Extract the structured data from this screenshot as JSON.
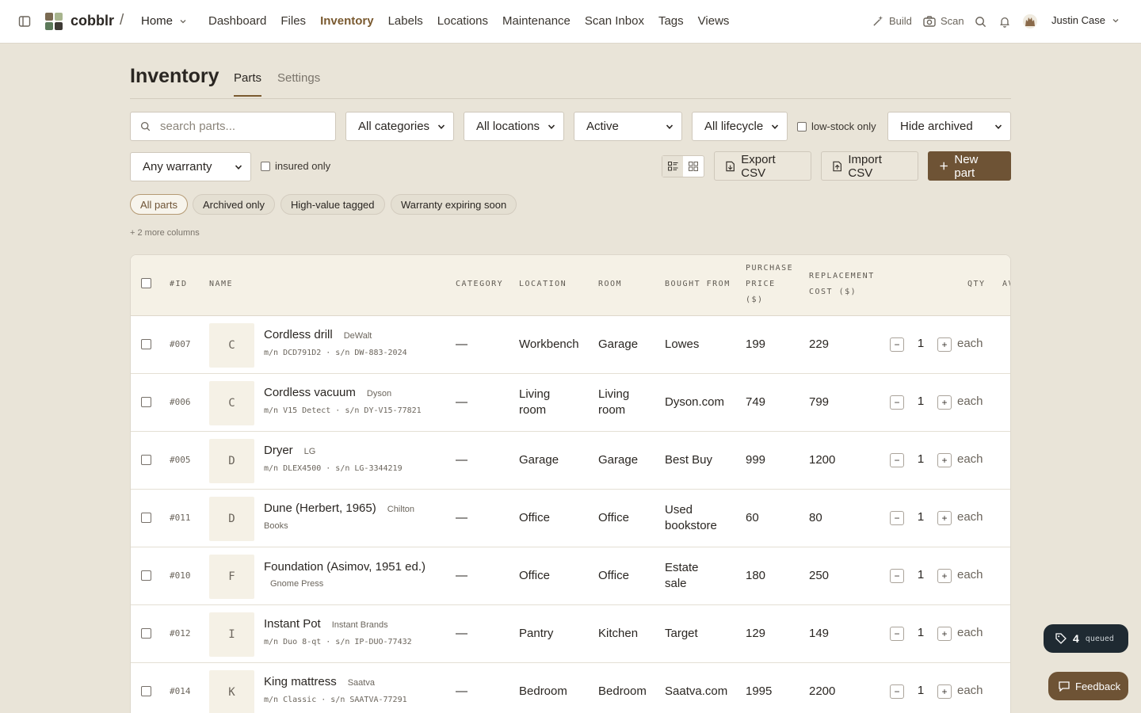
{
  "app": {
    "brand": "cobblr",
    "separator": "/",
    "home_label": "Home"
  },
  "nav": {
    "items": [
      {
        "label": "Dashboard",
        "active": false
      },
      {
        "label": "Files",
        "active": false
      },
      {
        "label": "Inventory",
        "active": true
      },
      {
        "label": "Labels",
        "active": false
      },
      {
        "label": "Locations",
        "active": false
      },
      {
        "label": "Maintenance",
        "active": false
      },
      {
        "label": "Scan Inbox",
        "active": false
      },
      {
        "label": "Tags",
        "active": false
      },
      {
        "label": "Views",
        "active": false
      }
    ]
  },
  "topright": {
    "build_label": "Build",
    "scan_label": "Scan",
    "user_name": "Justin Case"
  },
  "page": {
    "title": "Inventory",
    "tab_parts": "Parts",
    "tab_settings": "Settings"
  },
  "filters": {
    "search_placeholder": "search parts...",
    "category": "All categories",
    "location": "All locations",
    "status": "Active",
    "lifecycle": "All lifecycle",
    "low_stock_label": "low-stock only",
    "archived": "Hide archived",
    "warranty": "Any warranty",
    "insured_label": "insured only"
  },
  "actions": {
    "export_label": "Export CSV",
    "import_label": "Import CSV",
    "new_label": "New part"
  },
  "chips": [
    "All parts",
    "Archived only",
    "High-value tagged",
    "Warranty expiring soon"
  ],
  "more_columns": "+ 2 more columns",
  "table": {
    "headers": {
      "id": "#ID",
      "name": "NAME",
      "category": "CATEGORY",
      "location": "LOCATION",
      "room": "ROOM",
      "bought_from": "BOUGHT FROM",
      "purchase_price_1": "PURCHASE",
      "purchase_price_2": "PRICE",
      "purchase_price_3": "($)",
      "replacement_1": "REPLACEMENT",
      "replacement_2": "COST ($)",
      "qty": "QTY",
      "next_cut": "AV"
    },
    "rows": [
      {
        "id": "#007",
        "thumb": "C",
        "name": "Cordless drill",
        "brand": "DeWalt",
        "meta": "m/n DCD791D2 · s/n DW-883-2024",
        "category": "—",
        "location": "Workbench",
        "room": "Garage",
        "bought_from": "Lowes",
        "purchase": "199",
        "replacement": "229",
        "qty": "1",
        "unit": "each"
      },
      {
        "id": "#006",
        "thumb": "C",
        "name": "Cordless vacuum",
        "brand": "Dyson",
        "meta": "m/n V15 Detect · s/n DY-V15-77821",
        "category": "—",
        "location": "Living room",
        "room": "Living room",
        "bought_from": "Dyson.com",
        "purchase": "749",
        "replacement": "799",
        "qty": "1",
        "unit": "each"
      },
      {
        "id": "#005",
        "thumb": "D",
        "name": "Dryer",
        "brand": "LG",
        "meta": "m/n DLEX4500 · s/n LG-3344219",
        "category": "—",
        "location": "Garage",
        "room": "Garage",
        "bought_from": "Best Buy",
        "purchase": "999",
        "replacement": "1200",
        "qty": "1",
        "unit": "each"
      },
      {
        "id": "#011",
        "thumb": "D",
        "name": "Dune (Herbert, 1965)",
        "brand": "Chilton",
        "brand2": "Books",
        "meta": "",
        "category": "—",
        "location": "Office",
        "room": "Office",
        "bought_from": "Used bookstore",
        "purchase": "60",
        "replacement": "80",
        "qty": "1",
        "unit": "each"
      },
      {
        "id": "#010",
        "thumb": "F",
        "name": "Foundation (Asimov, 1951 ed.)",
        "brand": "",
        "brand2": "Gnome Press",
        "meta": "",
        "category": "—",
        "location": "Office",
        "room": "Office",
        "bought_from": "Estate sale",
        "purchase": "180",
        "replacement": "250",
        "qty": "1",
        "unit": "each"
      },
      {
        "id": "#012",
        "thumb": "I",
        "name": "Instant Pot",
        "brand": "Instant Brands",
        "meta": "m/n Duo 8-qt · s/n IP-DUO-77432",
        "category": "—",
        "location": "Pantry",
        "room": "Kitchen",
        "bought_from": "Target",
        "purchase": "129",
        "replacement": "149",
        "qty": "1",
        "unit": "each"
      },
      {
        "id": "#014",
        "thumb": "K",
        "name": "King mattress",
        "brand": "Saatva",
        "meta": "m/n Classic · s/n SAATVA-77291",
        "category": "—",
        "location": "Bedroom",
        "room": "Bedroom",
        "bought_from": "Saatva.com",
        "purchase": "1995",
        "replacement": "2200",
        "qty": "1",
        "unit": "each"
      }
    ]
  },
  "floating": {
    "queued_count": "4",
    "queued_label": "queued",
    "feedback_label": "Feedback"
  },
  "colors": {
    "accent": "#7a5a30",
    "primary_button": "#6e5335",
    "background": "#e9e4d8",
    "queued_bg": "#1f2a32"
  }
}
